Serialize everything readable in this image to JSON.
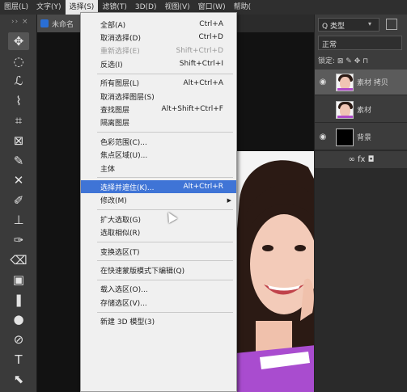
{
  "menubar": {
    "items": [
      {
        "label": "图层(L)"
      },
      {
        "label": "文字(Y)"
      },
      {
        "label": "选择(S)",
        "active": true
      },
      {
        "label": "滤镜(T)"
      },
      {
        "label": "3D(D)"
      },
      {
        "label": "视图(V)"
      },
      {
        "label": "窗口(W)"
      },
      {
        "label": "帮助("
      }
    ]
  },
  "document": {
    "tab_label": "未命名",
    "close_glyph": "×"
  },
  "toolbar": {
    "header": "›› ×",
    "tools": [
      {
        "name": "move-tool-icon",
        "glyph": "✥"
      },
      {
        "name": "marquee-tool-icon",
        "glyph": "◌"
      },
      {
        "name": "lasso-tool-icon",
        "glyph": "ℒ"
      },
      {
        "name": "quick-selection-tool-icon",
        "glyph": "⌇"
      },
      {
        "name": "crop-tool-icon",
        "glyph": "⌗"
      },
      {
        "name": "frame-tool-icon",
        "glyph": "⊠"
      },
      {
        "name": "eyedropper-tool-icon",
        "glyph": "✎"
      },
      {
        "name": "healing-brush-tool-icon",
        "glyph": "✕"
      },
      {
        "name": "brush-tool-icon",
        "glyph": "✐"
      },
      {
        "name": "clone-stamp-tool-icon",
        "glyph": "⊥"
      },
      {
        "name": "history-brush-tool-icon",
        "glyph": "✑"
      },
      {
        "name": "eraser-tool-icon",
        "glyph": "⌫"
      },
      {
        "name": "gradient-tool-icon",
        "glyph": "▣"
      },
      {
        "name": "blur-tool-icon",
        "glyph": "❚"
      },
      {
        "name": "dodge-tool-icon",
        "glyph": "●"
      },
      {
        "name": "pen-tool-icon",
        "glyph": "⊘"
      },
      {
        "name": "type-tool-icon",
        "glyph": "T"
      },
      {
        "name": "path-selection-tool-icon",
        "glyph": "⬉"
      }
    ]
  },
  "panel": {
    "search_label": "Q 类型",
    "dropdown_glyph": "▾",
    "blend_mode": "正常",
    "lock_label": "锁定: ⊠ ✎ ✥ ⊓",
    "layers": [
      {
        "name": "素材 拷贝",
        "visible": true,
        "selected": true
      },
      {
        "name": "素材",
        "visible": false,
        "selected": false
      },
      {
        "name": "背景",
        "visible": true,
        "selected": false
      }
    ],
    "footer_icons": "∞  fx  ◘"
  },
  "select_menu": {
    "items": [
      {
        "label": "全部(A)",
        "shortcut": "Ctrl+A"
      },
      {
        "label": "取消选择(D)",
        "shortcut": "Ctrl+D"
      },
      {
        "label": "重新选择(E)",
        "shortcut": "Shift+Ctrl+D",
        "disabled": true
      },
      {
        "label": "反选(I)",
        "shortcut": "Shift+Ctrl+I"
      },
      {
        "sep": true
      },
      {
        "label": "所有图层(L)",
        "shortcut": "Alt+Ctrl+A"
      },
      {
        "label": "取消选择图层(S)"
      },
      {
        "label": "查找图层",
        "shortcut": "Alt+Shift+Ctrl+F"
      },
      {
        "label": "隔离图层"
      },
      {
        "sep": true
      },
      {
        "label": "色彩范围(C)..."
      },
      {
        "label": "焦点区域(U)..."
      },
      {
        "label": "主体"
      },
      {
        "sep": true
      },
      {
        "label": "选择并遮住(K)...",
        "shortcut": "Alt+Ctrl+R",
        "highlighted": true
      },
      {
        "label": "修改(M)",
        "submenu": true
      },
      {
        "sep": true
      },
      {
        "label": "扩大选取(G)"
      },
      {
        "label": "选取相似(R)"
      },
      {
        "sep": true
      },
      {
        "label": "变换选区(T)"
      },
      {
        "sep": true
      },
      {
        "label": "在快速蒙版模式下编辑(Q)"
      },
      {
        "sep": true
      },
      {
        "label": "载入选区(O)..."
      },
      {
        "label": "存储选区(V)..."
      },
      {
        "sep": true
      },
      {
        "label": "新建 3D 模型(3)"
      }
    ]
  }
}
